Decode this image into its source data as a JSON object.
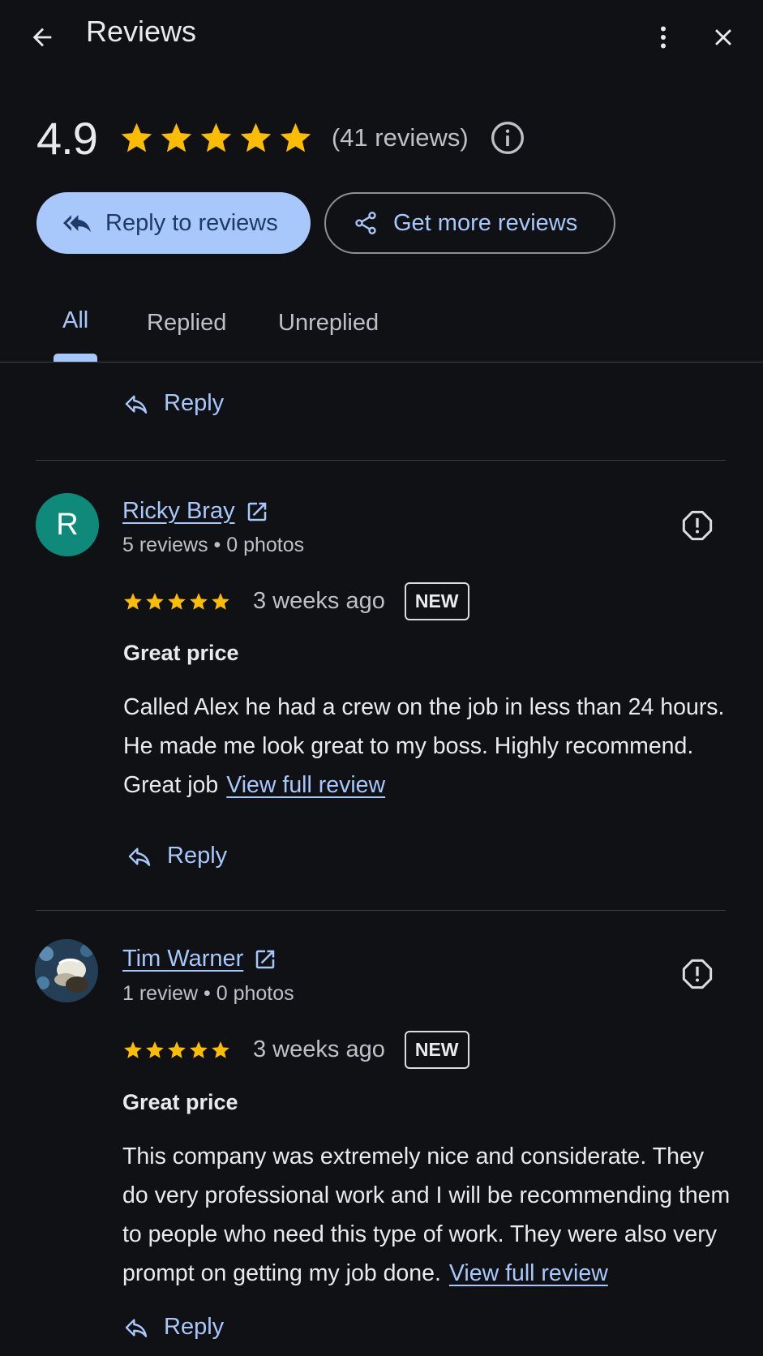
{
  "header": {
    "title": "Reviews",
    "back_icon": "arrow-left-icon",
    "more_icon": "more-vert-icon",
    "close_icon": "close-icon"
  },
  "summary": {
    "rating": "4.9",
    "stars": 5,
    "review_count": "(41 reviews)",
    "star_color": "#fbbc04"
  },
  "actions": {
    "reply_to_reviews": "Reply to reviews",
    "get_more_reviews": "Get more reviews"
  },
  "tabs": [
    {
      "label": "All",
      "active": true
    },
    {
      "label": "Replied",
      "active": false
    },
    {
      "label": "Unreplied",
      "active": false
    }
  ],
  "reply_label": "Reply",
  "reviews": [
    {
      "avatar_letter": "R",
      "avatar_color": "#0f8a7a",
      "name": "Ricky Bray",
      "meta": "5 reviews • 0 photos",
      "rating": 5,
      "time": "3 weeks ago",
      "badge": "NEW",
      "title": "Great price",
      "body": "Called Alex he had a crew on the job in less than 24 hours. He made me look great to my boss. Highly recommend. Great job",
      "view_full": "View full review"
    },
    {
      "avatar_letter": "",
      "name": "Tim Warner",
      "meta": "1 review • 0 photos",
      "rating": 5,
      "time": "3 weeks ago",
      "badge": "NEW",
      "title": "Great price",
      "body": "This company was extremely nice and considerate. They do very professional work and I will be recommending them to people who need this type of work. They were also very prompt on getting my job done.",
      "view_full": "View full review"
    }
  ]
}
